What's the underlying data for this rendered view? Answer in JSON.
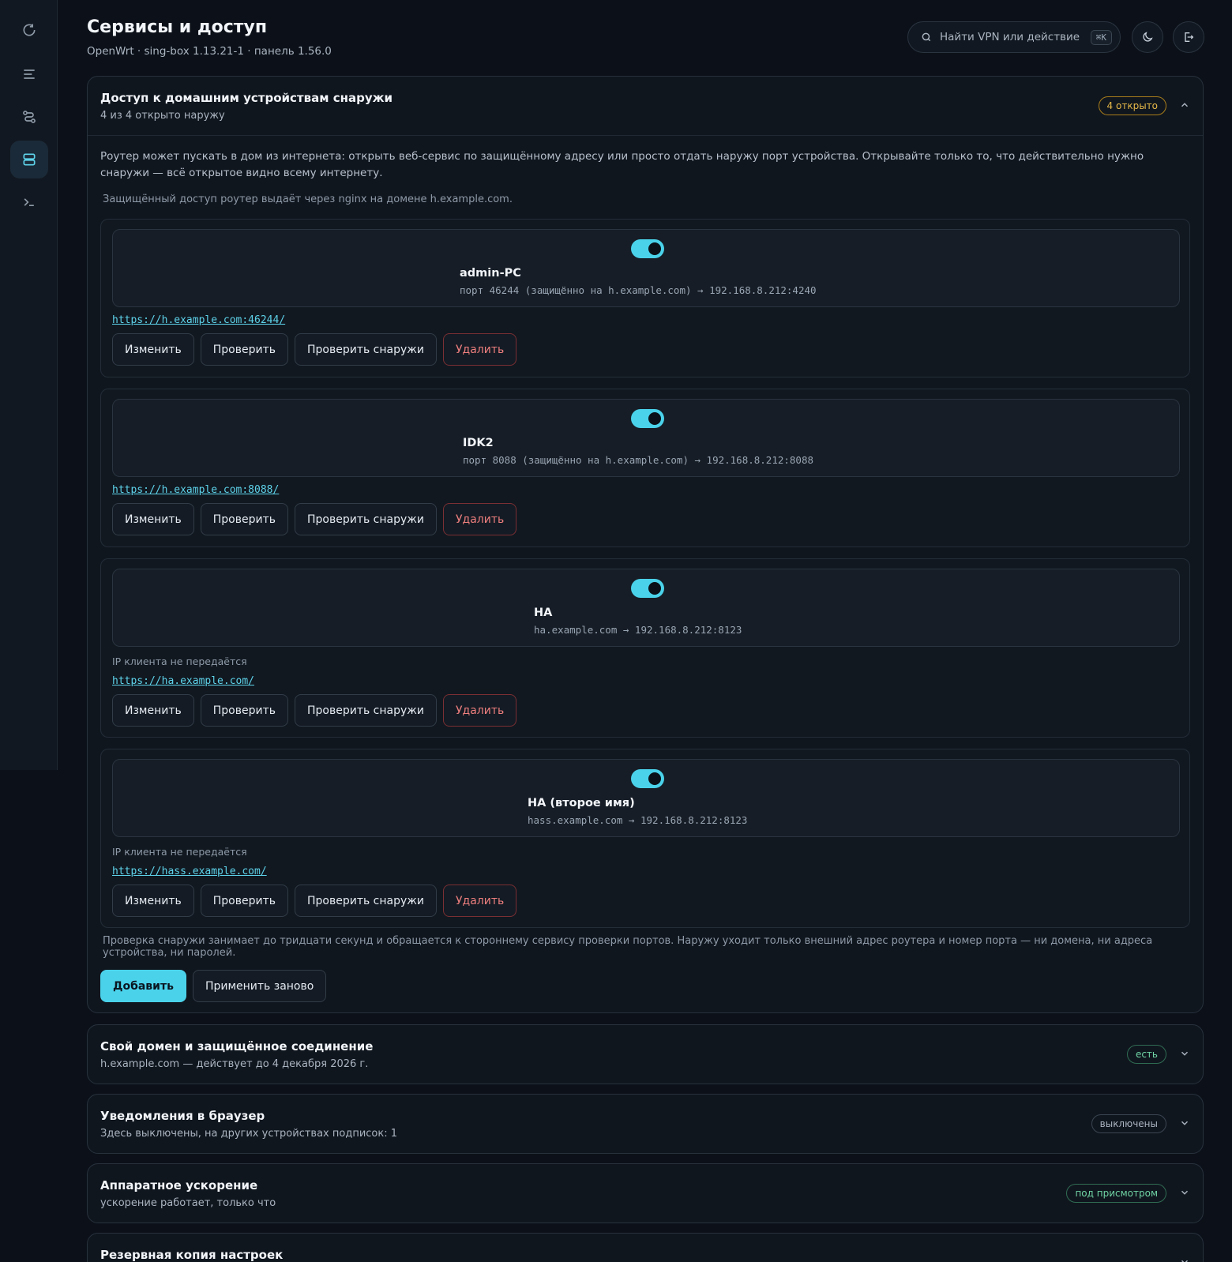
{
  "header": {
    "title": "Сервисы и доступ",
    "subtitle": "OpenWrt · sing-box 1.13.21-1 · панель 1.56.0",
    "search_placeholder": "Найти VPN или действие",
    "search_shortcut": "⌘K"
  },
  "sidebar": {
    "items": [
      {
        "icon": "refresh-icon",
        "active": false
      },
      {
        "icon": "menu-icon",
        "active": false
      },
      {
        "icon": "route-icon",
        "active": false
      },
      {
        "icon": "server-icon",
        "active": true
      },
      {
        "icon": "terminal-icon",
        "active": false
      }
    ]
  },
  "access_panel": {
    "title": "Доступ к домашним устройствам снаружи",
    "subtitle": "4 из 4 открыто наружу",
    "badge": "4 открыто",
    "intro": "Роутер может пускать в дом из интернета: открыть веб-сервис по защищённому адресу или просто отдать наружу порт устройства. Открывайте только то, что действительно нужно снаружи — всё открытое видно всему интернету.",
    "nginx_note": "Защищённый доступ роутер выдаёт через nginx на домене h.example.com.",
    "services": [
      {
        "name": "admin-PC",
        "detail": "порт 46244 (защищённо на h.example.com) → 192.168.8.212:4240",
        "note": "",
        "link": "https://h.example.com:46244/",
        "enabled": true
      },
      {
        "name": "IDK2",
        "detail": "порт 8088 (защищённо на h.example.com) → 192.168.8.212:8088",
        "note": "",
        "link": "https://h.example.com:8088/",
        "enabled": true
      },
      {
        "name": "HA",
        "detail": "ha.example.com → 192.168.8.212:8123",
        "note": "IP клиента не передаётся",
        "link": "https://ha.example.com/",
        "enabled": true
      },
      {
        "name": "HA (второе имя)",
        "detail": "hass.example.com → 192.168.8.212:8123",
        "note": "IP клиента не передаётся",
        "link": "https://hass.example.com/",
        "enabled": true
      }
    ],
    "buttons": {
      "edit": "Изменить",
      "check": "Проверить",
      "check_outside": "Проверить снаружи",
      "delete": "Удалить"
    },
    "footnote": "Проверка снаружи занимает до тридцати секунд и обращается к стороннему сервису проверки портов. Наружу уходит только внешний адрес роутера и номер порта — ни домена, ни адреса устройства, ни паролей.",
    "add_label": "Добавить",
    "reapply_label": "Применить заново"
  },
  "panels": [
    {
      "title": "Свой домен и защищённое соединение",
      "subtitle": "h.example.com — действует до 4 декабря 2026 г.",
      "badge": "есть",
      "badge_color": "#6fd3a4"
    },
    {
      "title": "Уведомления в браузер",
      "subtitle": "Здесь выключены, на других устройствах подписок: 1",
      "badge": "выключены",
      "badge_color": "#aab4c0"
    },
    {
      "title": "Аппаратное ускорение",
      "subtitle": "ускорение работает, только что",
      "badge": "под присмотром",
      "badge_color": "#6fd3a4"
    },
    {
      "title": "Резервная копия настроек",
      "subtitle": "",
      "badge": "",
      "badge_color": ""
    }
  ],
  "colors": {
    "accent": "#4ad2ea",
    "danger": "#ef7f7f",
    "warning": "#e5b849",
    "background": "#0c1119"
  }
}
